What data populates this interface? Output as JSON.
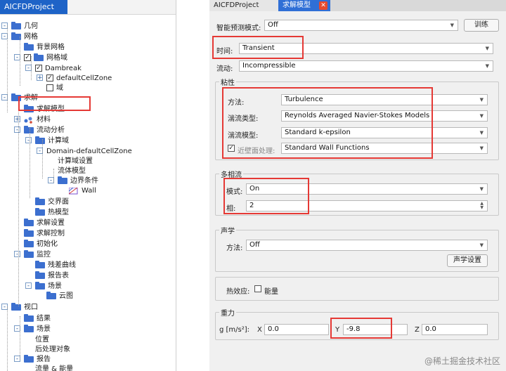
{
  "tree": {
    "title": "AICFDProject",
    "rows": [
      {
        "label": "几何",
        "exp": "-",
        "icon": "folder"
      },
      {
        "label": "网格",
        "exp": "-",
        "icon": "folder"
      },
      {
        "label": "背景网格",
        "icon": "folder"
      },
      {
        "label": "网格域",
        "exp": "-",
        "check": "✓",
        "icon": "folder"
      },
      {
        "label": "Dambreak",
        "exp": "-",
        "check": "✓"
      },
      {
        "label": "defaultCellZone",
        "exp": "+",
        "check": "✓"
      },
      {
        "label": "域",
        "check": ""
      },
      {
        "label": "求解",
        "exp": "-",
        "icon": "folder"
      },
      {
        "label": "求解模型",
        "icon": "folder"
      },
      {
        "label": "材料",
        "exp": "+",
        "icon": "material"
      },
      {
        "label": "流动分析",
        "exp": "-",
        "icon": "folder"
      },
      {
        "label": "计算域",
        "exp": "-",
        "icon": "folder"
      },
      {
        "label": "Domain-defaultCellZone",
        "exp": "-"
      },
      {
        "label": "计算域设置"
      },
      {
        "label": "流体模型"
      },
      {
        "label": "边界条件",
        "exp": "-",
        "icon": "folder"
      },
      {
        "label": "Wall",
        "icon": "wall"
      },
      {
        "label": "交界面",
        "icon": "folder"
      },
      {
        "label": "热模型",
        "icon": "folder"
      },
      {
        "label": "求解设置",
        "icon": "folder"
      },
      {
        "label": "求解控制",
        "icon": "folder"
      },
      {
        "label": "初始化",
        "icon": "folder"
      },
      {
        "label": "监控",
        "exp": "-",
        "icon": "folder"
      },
      {
        "label": "残差曲线",
        "icon": "folder"
      },
      {
        "label": "报告表",
        "icon": "folder"
      },
      {
        "label": "场景",
        "exp": "-",
        "icon": "folder"
      },
      {
        "label": "云图",
        "icon": "folder"
      },
      {
        "label": "视口",
        "exp": "-",
        "icon": "folder"
      },
      {
        "label": "结果",
        "icon": "folder"
      },
      {
        "label": "场景",
        "exp": "-",
        "icon": "folder"
      },
      {
        "label": "位置"
      },
      {
        "label": "后处理对象"
      },
      {
        "label": "报告",
        "exp": "-",
        "icon": "folder"
      },
      {
        "label": "流量 & 能量"
      }
    ]
  },
  "tabs": {
    "project": "AICFDProject",
    "solver": "求解模型",
    "close": "✕"
  },
  "smart": {
    "label": "智能预测模式:",
    "value": "Off",
    "train_button": "训练"
  },
  "time": {
    "label": "时间:",
    "value": "Transient"
  },
  "flow": {
    "label": "流动:",
    "value": "Incompressible"
  },
  "viscosity": {
    "title": "粘性",
    "method_label": "方法:",
    "method_value": "Turbulence",
    "turb_type_label": "湍流类型:",
    "turb_type_value": "Reynolds Averaged Navier-Stokes Models",
    "turb_model_label": "湍流模型:",
    "turb_model_value": "Standard k-epsilon",
    "wall_label": "近壁面处理:",
    "wall_value": "Standard Wall Functions",
    "wall_check": "✓"
  },
  "multiphase": {
    "title": "多相流",
    "mode_label": "模式:",
    "mode_value": "On",
    "phase_label": "相:",
    "phase_value": "2"
  },
  "acoustics": {
    "title": "声学",
    "method_label": "方法:",
    "method_value": "Off",
    "settings_button": "声学设置"
  },
  "thermal": {
    "label": "热效应:",
    "energy_label": "能量"
  },
  "gravity": {
    "title": "重力",
    "label": "g [m/s²]:",
    "x_label": "X",
    "x_value": "0.0",
    "y_label": "Y",
    "y_value": "-9.8",
    "z_label": "Z",
    "z_value": "0.0"
  },
  "watermark": "@稀土掘金技术社区",
  "colors": {
    "accent": "#2f6fd6",
    "highlight": "#e53935",
    "folder": "#3c6fcf"
  }
}
